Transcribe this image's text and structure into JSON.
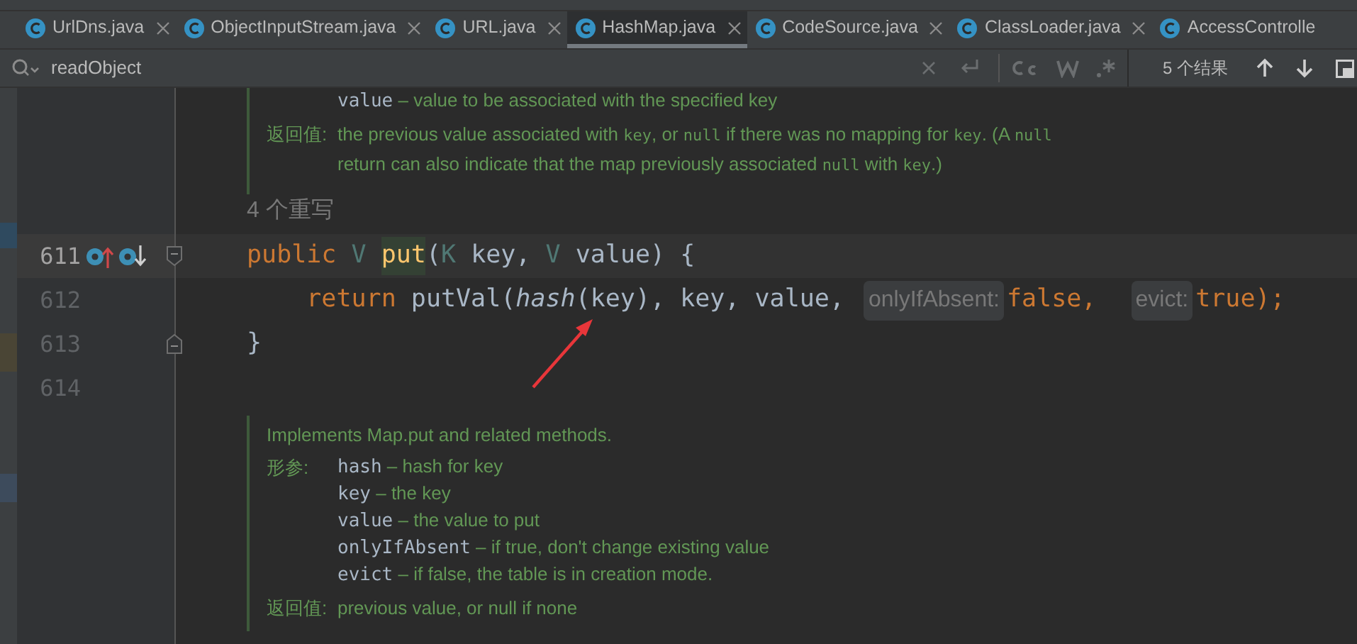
{
  "tabs": [
    {
      "label": "UrlDns.java",
      "selected": false,
      "closable": true
    },
    {
      "label": "ObjectInputStream.java",
      "selected": false,
      "closable": true
    },
    {
      "label": "URL.java",
      "selected": false,
      "closable": true
    },
    {
      "label": "HashMap.java",
      "selected": true,
      "closable": true
    },
    {
      "label": "CodeSource.java",
      "selected": false,
      "closable": true
    },
    {
      "label": "ClassLoader.java",
      "selected": false,
      "closable": true
    },
    {
      "label": "AccessControlle",
      "selected": false,
      "closable": false
    }
  ],
  "search": {
    "query": "readObject",
    "result": "5 个结果"
  },
  "editor": {
    "doc_before": {
      "params": [
        {
          "name": "value",
          "desc": " – value to be associated with the specified key"
        }
      ],
      "return_label": "返回值:",
      "return_lines": [
        [
          {
            "text": "the previous value associated with ",
            "kind": "prose"
          },
          {
            "text": "key",
            "kind": "code"
          },
          {
            "text": ", or ",
            "kind": "prose"
          },
          {
            "text": "null",
            "kind": "code"
          },
          {
            "text": " if there was no mapping for ",
            "kind": "prose"
          },
          {
            "text": "key",
            "kind": "code"
          },
          {
            "text": ". (A ",
            "kind": "prose"
          },
          {
            "text": "null",
            "kind": "code"
          }
        ],
        [
          {
            "text": "return can also indicate that the map previously associated ",
            "kind": "prose"
          },
          {
            "text": "null",
            "kind": "code"
          },
          {
            "text": " with ",
            "kind": "prose"
          },
          {
            "text": "key",
            "kind": "code"
          },
          {
            "text": ".)",
            "kind": "prose"
          }
        ]
      ]
    },
    "overrides_label": "4 个重写",
    "lines": [
      {
        "number": "611",
        "current": true,
        "gutter_icons": [
          {
            "kind": "overrides"
          },
          {
            "kind": "overridden"
          },
          {
            "kind": "fold-start"
          }
        ],
        "tokens": [
          {
            "text": "public ",
            "kind": "keyword"
          },
          {
            "text": "V ",
            "kind": "type"
          },
          {
            "text": "put",
            "kind": "declaration",
            "highlighted": true
          },
          {
            "text": "(",
            "kind": "plain"
          },
          {
            "text": "K ",
            "kind": "type"
          },
          {
            "text": "key, ",
            "kind": "plain"
          },
          {
            "text": "V ",
            "kind": "type"
          },
          {
            "text": "value) {",
            "kind": "plain"
          }
        ]
      },
      {
        "number": "612",
        "current": false,
        "tokens": [
          {
            "text": "    return ",
            "kind": "keyword"
          },
          {
            "text": "putVal(",
            "kind": "plain"
          },
          {
            "text": "hash",
            "kind": "static-call"
          },
          {
            "text": "(key), key, value,",
            "kind": "plain"
          },
          {
            "text": "onlyIfAbsent:",
            "kind": "hint"
          },
          {
            "text": "false, ",
            "kind": "keyword"
          },
          {
            "text": "evict:",
            "kind": "hint"
          },
          {
            "text": "true",
            "kind": "keyword"
          },
          {
            "text": ");",
            "kind": "keyword"
          }
        ]
      },
      {
        "number": "613",
        "current": false,
        "gutter_icons": [
          {
            "kind": "fold-end"
          }
        ],
        "tokens": [
          {
            "text": "}",
            "kind": "plain"
          }
        ]
      },
      {
        "number": "614",
        "current": false
      }
    ],
    "doc_after": {
      "summary": "Implements Map.put and related methods.",
      "params_label": "形参:",
      "params": [
        {
          "name": "hash",
          "desc": " – hash for key"
        },
        {
          "name": "key",
          "desc": " – the key"
        },
        {
          "name": "value",
          "desc": " – the value to put"
        },
        {
          "name": "onlyIfAbsent",
          "desc": " – if true, don't change existing value"
        },
        {
          "name": "evict",
          "desc": " – if false, the table is in creation mode."
        }
      ],
      "return_label": "返回值:",
      "return_lines": [
        [
          {
            "text": "previous value, or null if none",
            "kind": "prose"
          }
        ]
      ]
    }
  }
}
